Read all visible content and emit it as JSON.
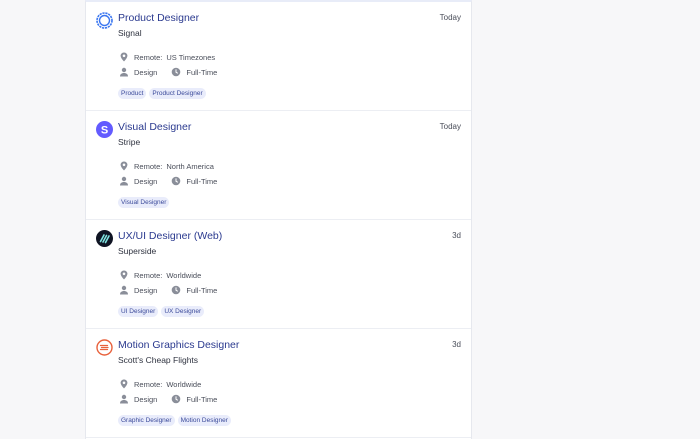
{
  "colors": {
    "title": "#2b3a8f",
    "tag_bg": "#e9ecfb",
    "tag_text": "#3b4a9a",
    "icon_gray": "#8a8e99"
  },
  "jobs": [
    {
      "logo_icon": "signal-logo-icon",
      "title": "Product Designer",
      "company": "Signal",
      "posted": "Today",
      "location_label": "Remote:",
      "location": "US Timezones",
      "category": "Design",
      "type": "Full-Time",
      "tags": [
        "Product",
        "Product Designer"
      ]
    },
    {
      "logo_icon": "stripe-logo-icon",
      "title": "Visual Designer",
      "company": "Stripe",
      "posted": "Today",
      "location_label": "Remote:",
      "location": "North America",
      "category": "Design",
      "type": "Full-Time",
      "tags": [
        "Visual Designer"
      ]
    },
    {
      "logo_icon": "superside-logo-icon",
      "title": "UX/UI Designer (Web)",
      "company": "Superside",
      "posted": "3d",
      "location_label": "Remote:",
      "location": "Worldwide",
      "category": "Design",
      "type": "Full-Time",
      "tags": [
        "UI Designer",
        "UX Designer"
      ]
    },
    {
      "logo_icon": "scotts-cheap-flights-logo-icon",
      "title": "Motion Graphics Designer",
      "company": "Scott's Cheap Flights",
      "posted": "3d",
      "location_label": "Remote:",
      "location": "Worldwide",
      "category": "Design",
      "type": "Full-Time",
      "tags": [
        "Graphic Designer",
        "Motion Designer"
      ]
    }
  ]
}
